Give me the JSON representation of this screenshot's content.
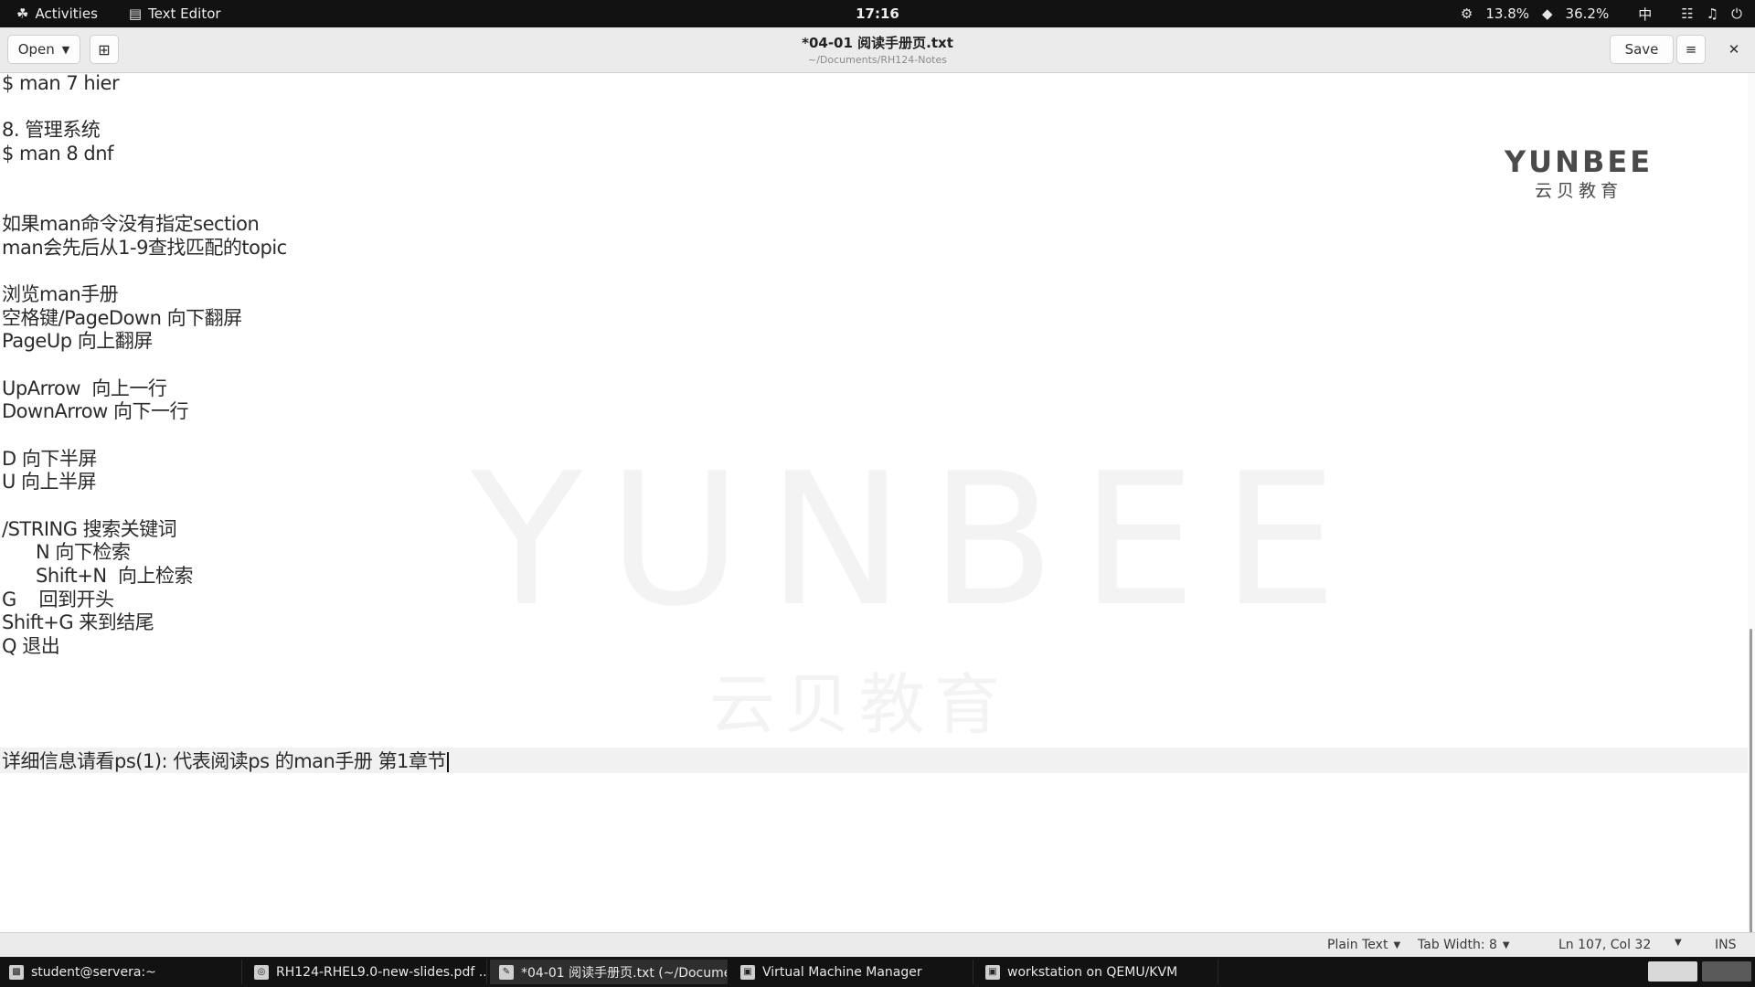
{
  "topbar": {
    "activities": "Activities",
    "app_name": "Text Editor",
    "clock": "17:16",
    "cpu": "13.8%",
    "mem": "36.2%",
    "input_method": "中"
  },
  "header": {
    "open_label": "Open",
    "title": "*04-01 阅读手册页.txt",
    "path": "~/Documents/RH124-Notes",
    "save_label": "Save"
  },
  "editor": {
    "lines": [
      "$ man 7 hier",
      "",
      "8. 管理系统",
      "$ man 8 dnf",
      "",
      "",
      "如果man命令没有指定section",
      "man会先后从1-9查找匹配的topic",
      "",
      "浏览man手册",
      "空格键/PageDown 向下翻屏",
      "PageUp 向上翻屏",
      "",
      "UpArrow  向上一行",
      "DownArrow 向下一行",
      "",
      "D 向下半屏",
      "U 向上半屏",
      "",
      "/STRING 搜索关键词",
      "      N 向下检索",
      "      Shift+N  向上检索",
      "G    回到开头",
      "Shift+G 来到结尾",
      "Q 退出",
      "",
      "",
      "",
      "",
      "详细信息请看ps(1): 代表阅读ps 的man手册 第1章节"
    ],
    "watermark_en": "YUNBEE",
    "watermark_cn": "云贝教育",
    "logo_en": "YUNBEE",
    "logo_cn": "云贝教育"
  },
  "statusbar": {
    "language": "Plain Text",
    "tab_width": "Tab Width: 8",
    "position": "Ln 107, Col 32",
    "mode": "INS"
  },
  "taskbar": {
    "tasks": [
      "student@servera:~",
      "RH124-RHEL9.0-new-slides.pdf ...",
      "*04-01 阅读手册页.txt (~/Docume...",
      "Virtual Machine Manager",
      "workstation on QEMU/KVM"
    ]
  }
}
